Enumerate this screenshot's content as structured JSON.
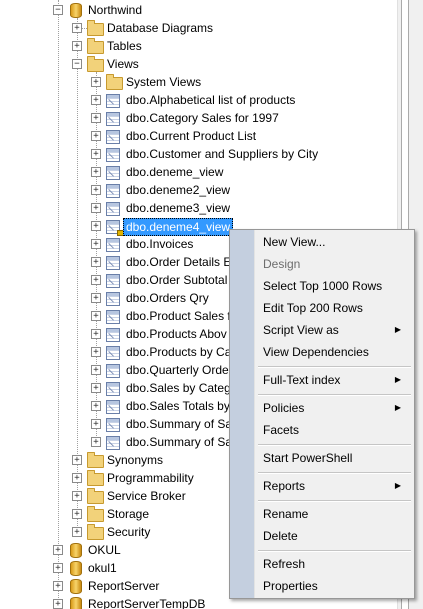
{
  "tree": {
    "root": "Northwind",
    "database_diagrams": "Database Diagrams",
    "tables": "Tables",
    "views": "Views",
    "system_views": "System Views",
    "view_items": [
      "dbo.Alphabetical list of products",
      "dbo.Category Sales for 1997",
      "dbo.Current Product List",
      "dbo.Customer and Suppliers by City",
      "dbo.deneme_view",
      "dbo.deneme2_view",
      "dbo.deneme3_view",
      "dbo.deneme4_view",
      "dbo.Invoices",
      "dbo.Order Details E",
      "dbo.Order Subtotal",
      "dbo.Orders Qry",
      "dbo.Product Sales f",
      "dbo.Products Abov",
      "dbo.Products by Ca",
      "dbo.Quarterly Orde",
      "dbo.Sales by Categ",
      "dbo.Sales Totals by",
      "dbo.Summary of Sa",
      "dbo.Summary of Sa"
    ],
    "other_folders": [
      "Synonyms",
      "Programmability",
      "Service Broker",
      "Storage",
      "Security"
    ],
    "databases": [
      "OKUL",
      "okul1",
      "ReportServer",
      "ReportServerTempDB"
    ],
    "selected_index": 7
  },
  "context_menu": {
    "new_view": "New View...",
    "design": "Design",
    "select_top": "Select Top 1000 Rows",
    "edit_top": "Edit Top 200 Rows",
    "script_view_as": "Script View as",
    "view_dependencies": "View Dependencies",
    "full_text_index": "Full-Text index",
    "policies": "Policies",
    "facets": "Facets",
    "start_powershell": "Start PowerShell",
    "reports": "Reports",
    "rename": "Rename",
    "delete": "Delete",
    "refresh": "Refresh",
    "properties": "Properties"
  },
  "icons": {
    "expanded": "minus-box-icon",
    "collapsed": "plus-box-icon",
    "submenu": "chevron-right-icon",
    "folder": "folder-icon",
    "database": "database-icon",
    "view": "view-icon"
  },
  "colors": {
    "selection": "#3399ff",
    "menu_gutter": "#c4cfdf",
    "menu_bg": "#f0f0f0"
  }
}
